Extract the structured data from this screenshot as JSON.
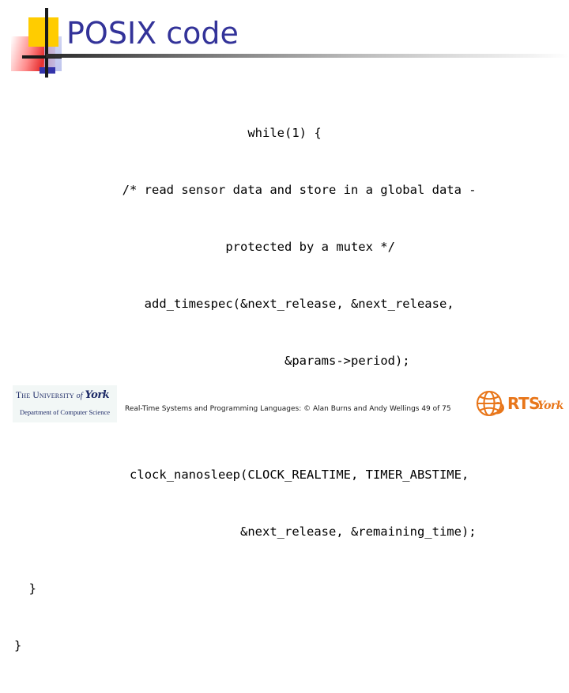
{
  "slide": {
    "title": "POSIX code",
    "title_color": "#333399",
    "background": "#ffffff"
  },
  "code": {
    "lines": [
      "while(1) {",
      "    /* read sensor data and store in a global data -",
      "       protected by a mutex */",
      "    add_timespec(&next_release, &next_release,",
      "                 &params->period);",
      "",
      "    clock_nanosleep(CLOCK_REALTIME, TIMER_ABSTIME,",
      "                    &next_release, &remaining_time);",
      "  }",
      "}"
    ]
  },
  "footer": {
    "credit": "Real-Time Systems and Programming Languages: © Alan Burns and Andy Wellings 49 of 75",
    "university_logo": {
      "the": "The ",
      "university": "University",
      "of": " of ",
      "york": "York",
      "department": "Department of Computer Science"
    },
    "rts_logo": {
      "acronym": "RTS",
      "york": "York",
      "color": "#e8761a"
    }
  },
  "decoration": {
    "yellow": "#ffcc00",
    "red": "#e52323",
    "blue": "#3333aa",
    "line": "#1a1a1a"
  }
}
